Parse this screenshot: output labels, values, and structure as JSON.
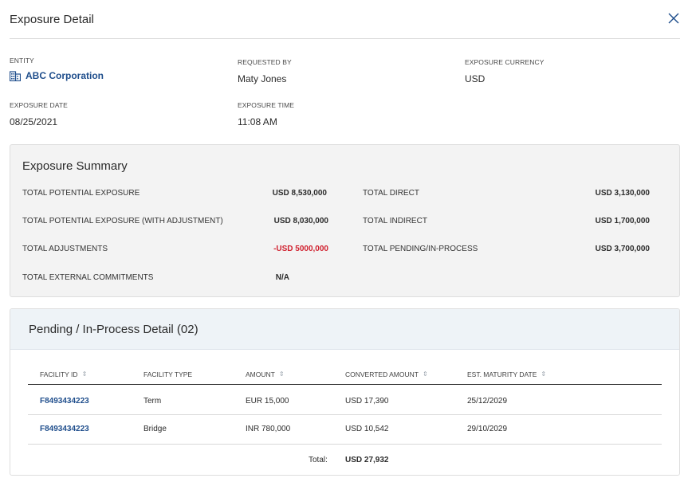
{
  "header": {
    "title": "Exposure Detail",
    "close_icon": "close-icon"
  },
  "fields": {
    "entity_label": "ENTITY",
    "entity_value": "ABC Corporation",
    "entity_icon": "building-icon",
    "requested_by_label": "REQUESTED BY",
    "requested_by_value": "Maty Jones",
    "currency_label": "EXPOSURE CURRENCY",
    "currency_value": "USD",
    "date_label": "EXPOSURE DATE",
    "date_value": "08/25/2021",
    "time_label": "EXPOSURE TIME",
    "time_value": "11:08 AM"
  },
  "summary": {
    "title": "Exposure Summary",
    "left": [
      {
        "label": "TOTAL POTENTIAL EXPOSURE",
        "value": "USD 8,530,000"
      },
      {
        "label": "TOTAL POTENTIAL EXPOSURE (WITH ADJUSTMENT)",
        "value": "USD 8,030,000"
      },
      {
        "label": "TOTAL ADJUSTMENTS",
        "value": "-USD 5000,000"
      },
      {
        "label": "TOTAL EXTERNAL COMMITMENTS",
        "value": "N/A"
      }
    ],
    "right": [
      {
        "label": "TOTAL DIRECT",
        "value": "USD 3,130,000"
      },
      {
        "label": "TOTAL INDIRECT",
        "value": "USD 1,700,000"
      },
      {
        "label": "TOTAL PENDING/IN-PROCESS",
        "value": "USD 3,700,000"
      }
    ],
    "negative_color": "#d0202e"
  },
  "pending": {
    "title": "Pending / In-Process Detail (02)",
    "columns": [
      "FACILITY ID",
      "FACILITY TYPE",
      "AMOUNT",
      "CONVERTED AMOUNT",
      "EST. MATURITY DATE"
    ],
    "rows": [
      {
        "facility_id": "F8493434223",
        "facility_type": "Term",
        "amount": "EUR 15,000",
        "converted": "USD 17,390",
        "maturity": "25/12/2029"
      },
      {
        "facility_id": "F8493434223",
        "facility_type": "Bridge",
        "amount": "INR 780,000",
        "converted": "USD 10,542",
        "maturity": "29/10/2029"
      }
    ],
    "total_label": "Total:",
    "total_value": "USD 27,932"
  },
  "colors": {
    "link": "#1f4e8c",
    "summary_bg": "#f3f3f3",
    "pending_header_bg": "#eef3f7"
  }
}
